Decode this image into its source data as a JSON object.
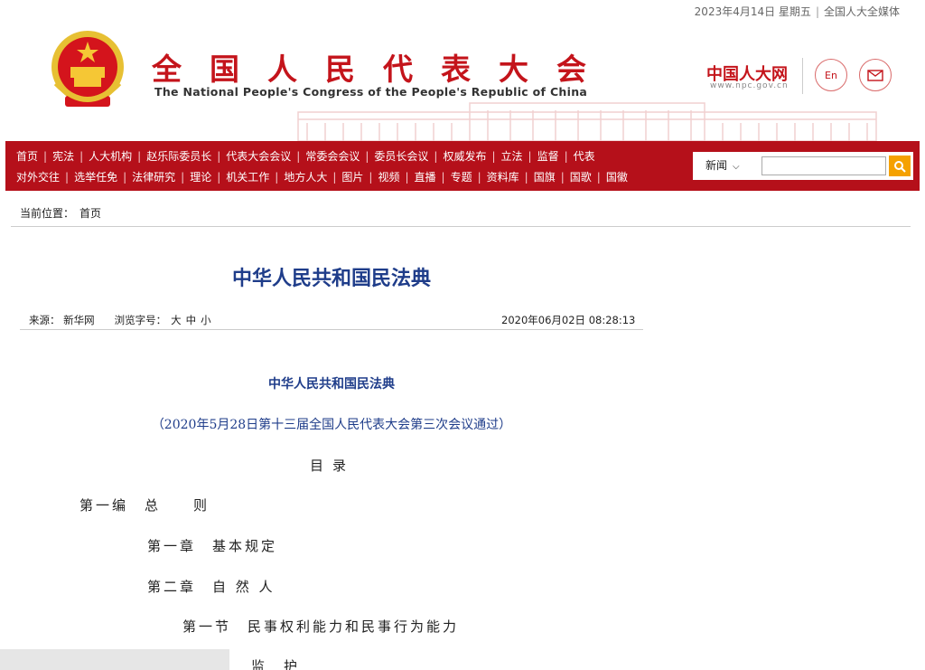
{
  "topbar": {
    "date": "2023年4月14日 星期五",
    "separator": "|",
    "media": "全国人大全媒体"
  },
  "header": {
    "cn_title": "全国人民代表大会",
    "en_title": "The National People's Congress of the People's Republic of China",
    "npc_logo": "中国人大网",
    "npc_url": "www.npc.gov.cn",
    "en_button": "En"
  },
  "nav": {
    "row1": [
      "首页",
      "宪法",
      "人大机构",
      "赵乐际委员长",
      "代表大会会议",
      "常委会会议",
      "委员长会议",
      "权威发布",
      "立法",
      "监督",
      "代表"
    ],
    "row2": [
      "对外交往",
      "选举任免",
      "法律研究",
      "理论",
      "机关工作",
      "地方人大",
      "图片",
      "视频",
      "直播",
      "专题",
      "资料库",
      "国旗",
      "国歌",
      "国徽"
    ],
    "separator": "|",
    "search_select": "新闻"
  },
  "breadcrumb": {
    "label": "当前位置：",
    "home": "首页"
  },
  "article": {
    "title": "中华人民共和国民法典",
    "source": "来源： 新华网",
    "font_size_label": "浏览字号：",
    "font_sizes": [
      "大",
      "中",
      "小"
    ],
    "timestamp": "2020年06月02日 08:28:13",
    "body_title": "中华人民共和国民法典",
    "body_subtitle": "（2020年5月28日第十三届全国人民代表大会第三次会议通过）",
    "toc_title": "目录",
    "toc": [
      "第一编　总　　则",
      "第一章　基本规定",
      "第二章　自 然 人",
      "第一节　民事权利能力和民事行为能力",
      "监　护"
    ]
  },
  "colors": {
    "brand_red": "#b5101a",
    "title_blue": "#1f3d8a",
    "search_button": "#f5a100"
  }
}
